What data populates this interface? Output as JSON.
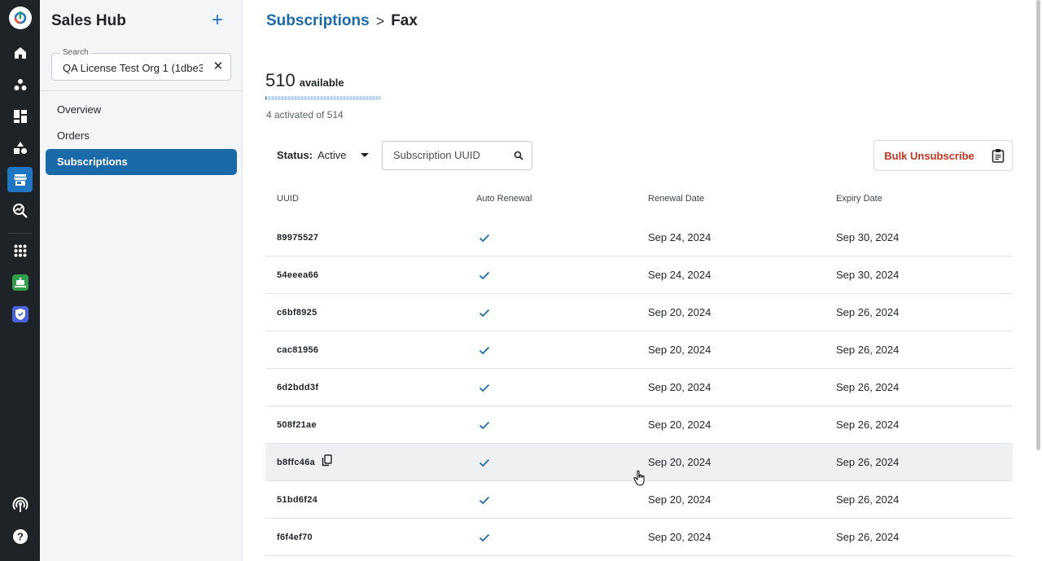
{
  "app": {
    "name": "Sales Hub"
  },
  "rail": {
    "items": [
      {
        "icon": "logo-icon"
      },
      {
        "icon": "home-icon"
      },
      {
        "icon": "clients-icon"
      },
      {
        "icon": "dashboard-icon"
      },
      {
        "icon": "shapes-icon"
      },
      {
        "icon": "store-icon",
        "active": true
      },
      {
        "icon": "analytics-search-icon"
      },
      {
        "icon": "apps-grid-icon"
      },
      {
        "icon": "bot-app-icon"
      },
      {
        "icon": "shield-app-icon"
      },
      {
        "icon": "broadcast-icon"
      },
      {
        "icon": "help-icon"
      }
    ]
  },
  "sidebar": {
    "title": "Sales Hub",
    "add_icon": "plus-icon",
    "search": {
      "label": "Search",
      "value": "QA License Test Org 1 (1dbe3",
      "clear_icon": "close-icon"
    },
    "nav": [
      {
        "label": "Overview",
        "active": false
      },
      {
        "label": "Orders",
        "active": false
      },
      {
        "label": "Subscriptions",
        "active": true
      }
    ]
  },
  "breadcrumb": {
    "parent": "Subscriptions",
    "separator": ">",
    "current": "Fax"
  },
  "summary": {
    "available_count": "510",
    "available_label": "available",
    "activated_text": "4 activated of 514",
    "activated_fraction": 0.0078
  },
  "toolbar": {
    "status_key": "Status:",
    "status_value": "Active",
    "search_placeholder": "Subscription UUID",
    "bulk_unsubscribe_label": "Bulk Unsubscribe",
    "clipboard_icon": "clipboard-icon"
  },
  "table": {
    "columns": [
      "UUID",
      "Auto Renewal",
      "Renewal Date",
      "Expiry Date"
    ],
    "rows": [
      {
        "uuid": "89975527",
        "auto_renewal": true,
        "renewal_date": "Sep 24, 2024",
        "expiry_date": "Sep 30, 2024"
      },
      {
        "uuid": "54eeea66",
        "auto_renewal": true,
        "renewal_date": "Sep 24, 2024",
        "expiry_date": "Sep 30, 2024"
      },
      {
        "uuid": "c6bf8925",
        "auto_renewal": true,
        "renewal_date": "Sep 20, 2024",
        "expiry_date": "Sep 26, 2024"
      },
      {
        "uuid": "cac81956",
        "auto_renewal": true,
        "renewal_date": "Sep 20, 2024",
        "expiry_date": "Sep 26, 2024"
      },
      {
        "uuid": "6d2bdd3f",
        "auto_renewal": true,
        "renewal_date": "Sep 20, 2024",
        "expiry_date": "Sep 26, 2024"
      },
      {
        "uuid": "508f21ae",
        "auto_renewal": true,
        "renewal_date": "Sep 20, 2024",
        "expiry_date": "Sep 26, 2024"
      },
      {
        "uuid": "b8ffc46a",
        "auto_renewal": true,
        "renewal_date": "Sep 20, 2024",
        "expiry_date": "Sep 26, 2024",
        "hovered": true,
        "copy_icon": "copy-icon"
      },
      {
        "uuid": "51bd6f24",
        "auto_renewal": true,
        "renewal_date": "Sep 20, 2024",
        "expiry_date": "Sep 26, 2024"
      },
      {
        "uuid": "f6f4ef70",
        "auto_renewal": true,
        "renewal_date": "Sep 20, 2024",
        "expiry_date": "Sep 26, 2024"
      }
    ]
  },
  "colors": {
    "accent": "#1a6aa9",
    "danger": "#c8341f",
    "rail_bg": "#1e2328",
    "check": "#1a6aa9"
  }
}
